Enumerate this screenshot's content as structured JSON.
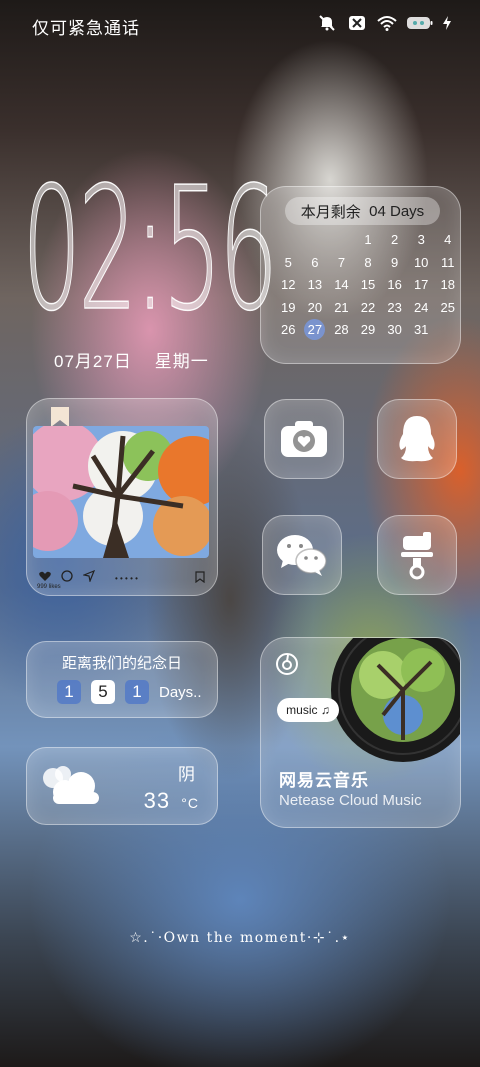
{
  "status_bar": {
    "carrier_text": "仅可紧急通话",
    "icons": [
      "mute-icon",
      "no-sim-icon",
      "wifi-icon",
      "battery-icon",
      "charging-icon"
    ]
  },
  "clock": {
    "time": "02:56",
    "date": "07月27日",
    "weekday": "星期一"
  },
  "calendar": {
    "remaining_label": "本月剩余",
    "remaining_value": "04 Days",
    "today": "27",
    "weeks": [
      [
        "",
        "",
        "",
        "1",
        "2",
        "3",
        "4"
      ],
      [
        "5",
        "6",
        "7",
        "8",
        "9",
        "10",
        "11"
      ],
      [
        "12",
        "13",
        "14",
        "15",
        "16",
        "17",
        "18"
      ],
      [
        "19",
        "20",
        "21",
        "22",
        "23",
        "24",
        "25"
      ],
      [
        "26",
        "27",
        "28",
        "29",
        "30",
        "31",
        ""
      ]
    ]
  },
  "photo_widget": {
    "likes": "999 likes",
    "dots": "• • • • •"
  },
  "apps": [
    {
      "name": "camera-app-icon"
    },
    {
      "name": "qq-app-icon"
    },
    {
      "name": "wechat-app-icon"
    },
    {
      "name": "brush-app-icon"
    }
  ],
  "anniversary": {
    "title": "距离我们的纪念日",
    "digits": [
      "1",
      "5",
      "1"
    ],
    "unit": "Days.."
  },
  "weather": {
    "condition": "阴",
    "temperature": "33",
    "unit": "°C"
  },
  "music": {
    "title": "网易云音乐",
    "subtitle": "Netease Cloud Music",
    "tag": "music ♫"
  },
  "slogan": "☆.˙·Own the moment·⊹˙.⋆"
}
